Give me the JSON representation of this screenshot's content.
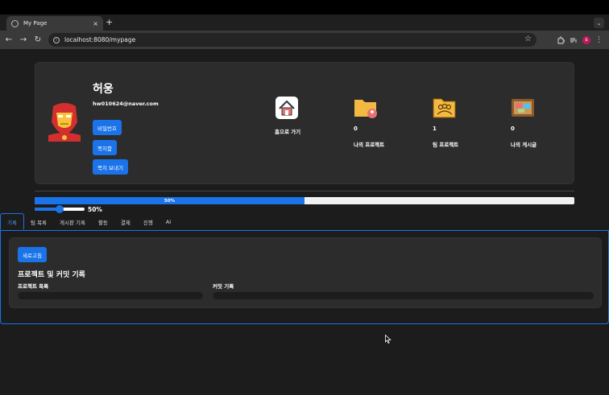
{
  "browser": {
    "tab_title": "My Page",
    "tab_close": "×",
    "new_tab": "+",
    "tab_menu": "⌄",
    "url": "localhost:8080/mypage",
    "back": "←",
    "forward": "→",
    "reload": "↻",
    "bookmark": "☆",
    "profile_initial": "s"
  },
  "profile": {
    "name": "허웅",
    "email": "hw010624@naver.com",
    "buttons": {
      "password": "비밀번호",
      "messages": "쪽지함",
      "send_message": "쪽지 보내기"
    }
  },
  "stats": {
    "home": {
      "label": "홈으로 가기"
    },
    "my_projects": {
      "count": "0",
      "label": "나의 프로젝트"
    },
    "team_projects": {
      "count": "1",
      "label": "팀 프로젝트"
    },
    "my_posts": {
      "count": "0",
      "label": "나의 게시글"
    }
  },
  "progress": {
    "value": 0.5,
    "label": "50%"
  },
  "slider": {
    "value": 0.5,
    "label": "50%"
  },
  "tabs": [
    "기록",
    "팀 목록",
    "게시판 기록",
    "활동",
    "결제",
    "진행",
    "AI"
  ],
  "active_tab": 0,
  "content": {
    "refresh_button": "새로고침",
    "section_title": "프로젝트 및 커밋 기록",
    "project_list_label": "프로젝트 목록",
    "commit_log_label": "커밋 기록"
  },
  "colors": {
    "accent": "#1a73e8",
    "card": "#2c2c2c",
    "background": "#1c1c1c"
  }
}
